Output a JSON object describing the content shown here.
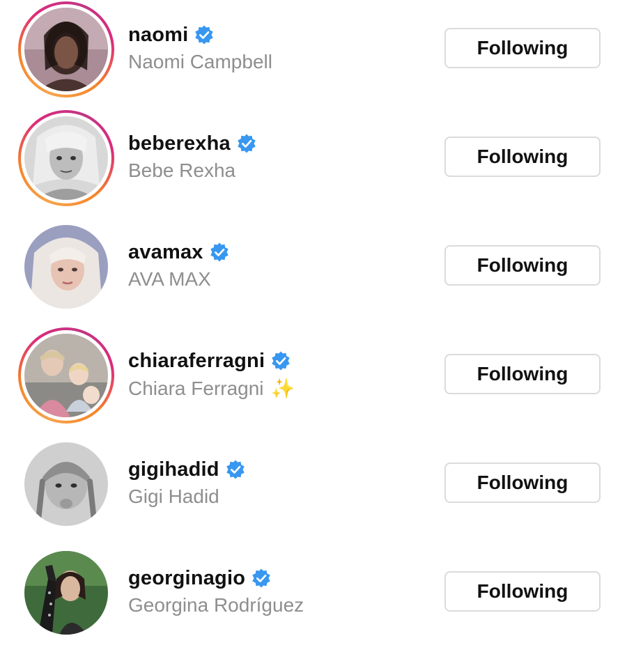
{
  "accounts": [
    {
      "username": "naomi",
      "full_name": "Naomi Campbell",
      "verified": true,
      "story_ring": true,
      "avatar_icon": "avatar-photo",
      "button_label": "Following"
    },
    {
      "username": "beberexha",
      "full_name": "Bebe Rexha",
      "verified": true,
      "story_ring": true,
      "avatar_icon": "avatar-photo",
      "button_label": "Following"
    },
    {
      "username": "avamax",
      "full_name": "AVA MAX",
      "verified": true,
      "story_ring": false,
      "avatar_icon": "avatar-photo",
      "button_label": "Following"
    },
    {
      "username": "chiaraferragni",
      "full_name": "Chiara Ferragni",
      "full_name_emoji": "✨",
      "verified": true,
      "story_ring": true,
      "avatar_icon": "avatar-photo",
      "button_label": "Following"
    },
    {
      "username": "gigihadid",
      "full_name": "Gigi Hadid",
      "verified": true,
      "story_ring": false,
      "avatar_icon": "avatar-photo",
      "button_label": "Following"
    },
    {
      "username": "georginagio",
      "full_name": "Georgina Rodríguez",
      "verified": true,
      "story_ring": false,
      "avatar_icon": "avatar-photo",
      "button_label": "Following"
    }
  ],
  "colors": {
    "verified_badge": "#3897f0",
    "username_text": "#111111",
    "fullname_text": "#8e8e8e",
    "button_border": "#dbdbdb",
    "story_ring_start": "#f58529",
    "story_ring_end": "#dd2a7b"
  }
}
